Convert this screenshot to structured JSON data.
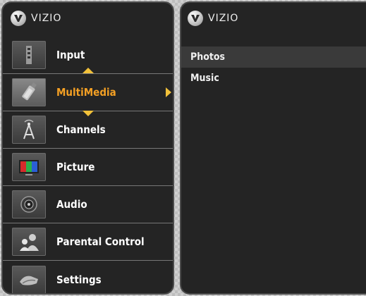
{
  "brand": {
    "logo_text": "VIZIO"
  },
  "menu": {
    "items": [
      {
        "label": "Input",
        "icon": "input-icon"
      },
      {
        "label": "MultiMedia",
        "icon": "usb-drive-icon",
        "active": true
      },
      {
        "label": "Channels",
        "icon": "antenna-icon"
      },
      {
        "label": "Picture",
        "icon": "picture-monitor-icon"
      },
      {
        "label": "Audio",
        "icon": "speaker-icon"
      },
      {
        "label": "Parental Control",
        "icon": "parental-control-icon"
      },
      {
        "label": "Settings",
        "icon": "settings-icon"
      }
    ],
    "active_color": "#f4a024",
    "arrow_color": "#f2c13a"
  },
  "submenu": {
    "items": [
      {
        "label": "Photos",
        "selected": true
      },
      {
        "label": "Music"
      }
    ]
  }
}
